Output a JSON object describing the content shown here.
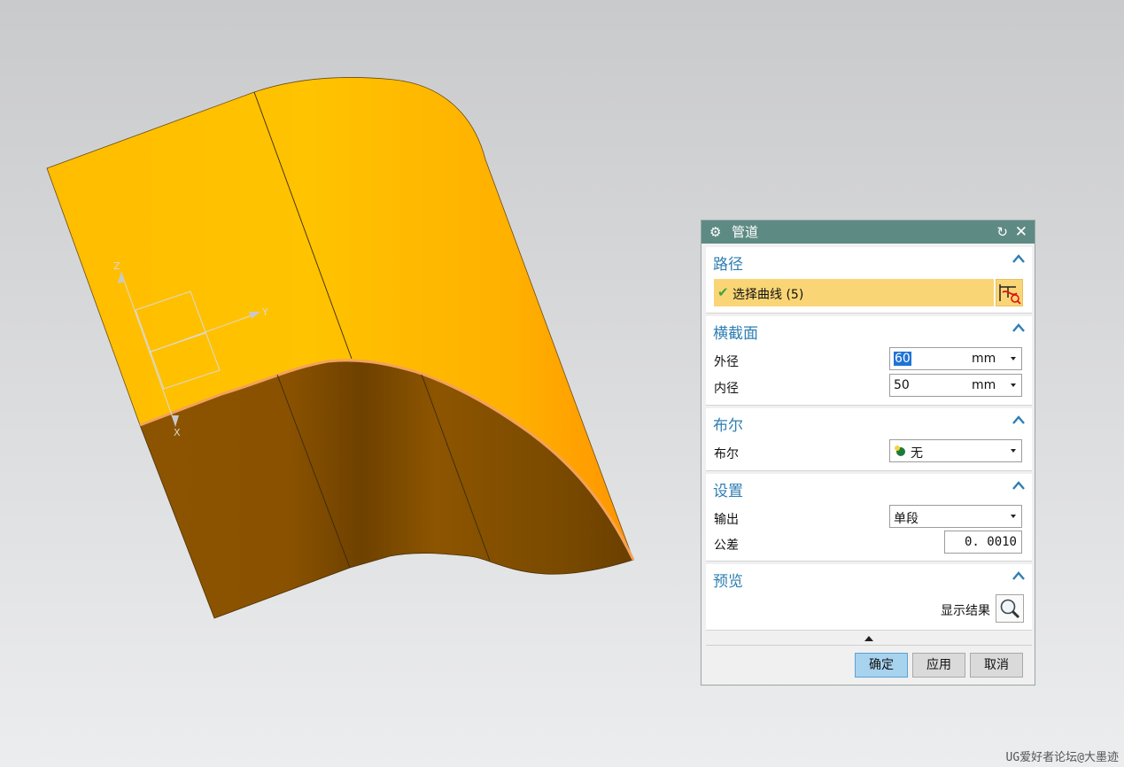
{
  "viewport": {
    "triad": {
      "z_label": "Z",
      "y_label": "Y",
      "x_label": "X"
    },
    "colors": {
      "pipe_outer": "#ffc000",
      "pipe_inner": "#8c5400",
      "background_top": "#c9cacc",
      "background_bottom": "#ecedee"
    }
  },
  "dialog": {
    "title": "管道",
    "title_icons": {
      "gear": "gear-icon",
      "reset": "reset-icon",
      "close": "close-icon"
    },
    "sections": {
      "path": {
        "title": "路径",
        "select_curve_label": "选择曲线 (5)",
        "curve_button_icon": "curve-select-icon"
      },
      "cross_section": {
        "title": "横截面",
        "outer_label": "外径",
        "outer_value": "60",
        "outer_unit": "mm",
        "inner_label": "内径",
        "inner_value": "50",
        "inner_unit": "mm"
      },
      "boolean": {
        "title": "布尔",
        "label": "布尔",
        "value": "无"
      },
      "settings": {
        "title": "设置",
        "output_label": "输出",
        "output_value": "单段",
        "tolerance_label": "公差",
        "tolerance_value": "0. 0010"
      },
      "preview": {
        "title": "预览",
        "show_result_label": "显示结果"
      }
    },
    "buttons": {
      "ok": "确定",
      "apply": "应用",
      "cancel": "取消"
    },
    "accent_color": "#2f7fb3",
    "titlebar_color": "#5e8a84"
  },
  "watermark": "UG爱好者论坛@大墨迹"
}
